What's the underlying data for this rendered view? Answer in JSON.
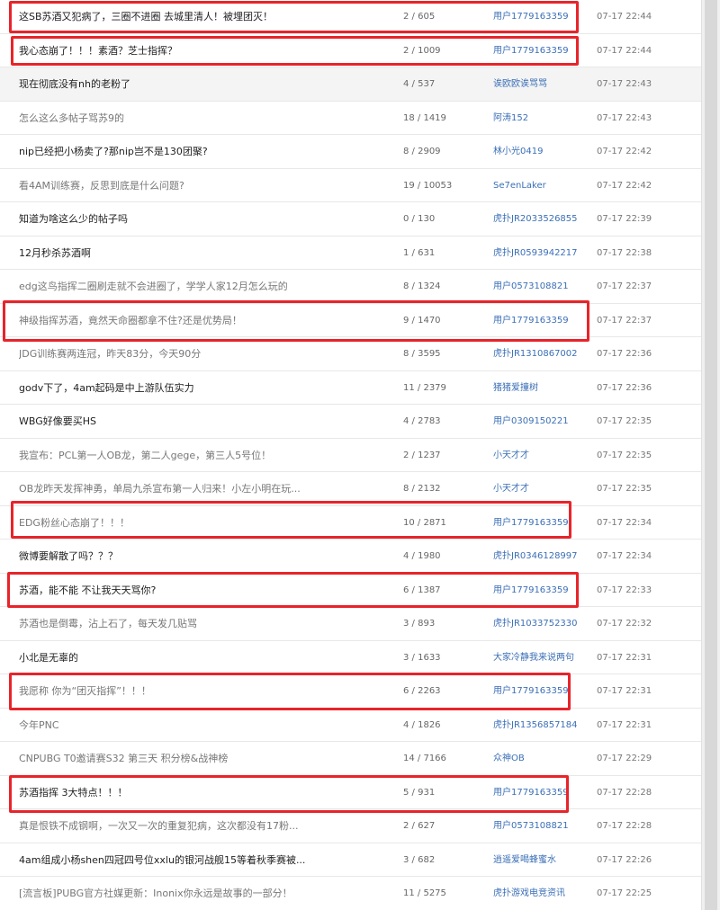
{
  "rows": [
    {
      "title": "这SB苏酒又犯病了，三圈不进圈 去城里清人！被埋团灭！",
      "count": "2 / 605",
      "user": "用户1779163359",
      "time": "07-17 22:44"
    },
    {
      "title": "我心态崩了！！！素酒？芝士指挥？",
      "count": "2 / 1009",
      "user": "用户1779163359",
      "time": "07-17 22:44"
    },
    {
      "title": "现在彻底没有nh的老粉了",
      "count": "4 / 537",
      "user": "诶欧欧诶骂骂",
      "time": "07-17 22:43"
    },
    {
      "title": "怎么这么多帖子骂苏9的",
      "count": "18 / 1419",
      "user": "阿涛152",
      "time": "07-17 22:43"
    },
    {
      "title": "nip已经把小杨卖了?那nip岂不是130团聚?",
      "count": "8 / 2909",
      "user": "林小光0419",
      "time": "07-17 22:42"
    },
    {
      "title": "看4AM训练赛，反思到底是什么问题?",
      "count": "19 / 10053",
      "user": "Se7enLaker",
      "time": "07-17 22:42"
    },
    {
      "title": "知道为啥这么少的帖子吗",
      "count": "0 / 130",
      "user": "虎扑JR2033526855",
      "time": "07-17 22:39"
    },
    {
      "title": "12月秒杀苏酒啊",
      "count": "1 / 631",
      "user": "虎扑JR0593942217",
      "time": "07-17 22:38"
    },
    {
      "title": "edg这鸟指挥二圈刷走就不会进圈了，学学人家12月怎么玩的",
      "count": "8 / 1324",
      "user": "用户0573108821",
      "time": "07-17 22:37"
    },
    {
      "title": "神级指挥苏酒，竟然天命圈都拿不住?还是优势局！",
      "count": "9 / 1470",
      "user": "用户1779163359",
      "time": "07-17 22:37"
    },
    {
      "title": "JDG训练赛两连冠，昨天83分，今天90分",
      "count": "8 / 3595",
      "user": "虎扑JR1310867002",
      "time": "07-17 22:36"
    },
    {
      "title": "godv下了，4am起码是中上游队伍实力",
      "count": "11 / 2379",
      "user": "猪猪爱撞树",
      "time": "07-17 22:36"
    },
    {
      "title": "WBG好像要买HS",
      "count": "4 / 2783",
      "user": "用户0309150221",
      "time": "07-17 22:35"
    },
    {
      "title": "我宣布：PCL第一人OB龙，第二人gege，第三人5号位！",
      "count": "2 / 1237",
      "user": "小天才才",
      "time": "07-17 22:35"
    },
    {
      "title": "OB龙昨天发挥神勇，单局九杀宣布第一人归来！小左小明在玩...",
      "count": "8 / 2132",
      "user": "小天才才",
      "time": "07-17 22:35"
    },
    {
      "title": "EDG粉丝心态崩了！！！",
      "count": "10 / 2871",
      "user": "用户1779163359",
      "time": "07-17 22:34"
    },
    {
      "title": "微博要解散了吗？？？",
      "count": "4 / 1980",
      "user": "虎扑JR0346128997",
      "time": "07-17 22:34"
    },
    {
      "title": "苏酒，能不能 不让我天天骂你?",
      "count": "6 / 1387",
      "user": "用户1779163359",
      "time": "07-17 22:33"
    },
    {
      "title": "苏酒也是倒霉，沾上石了，每天发几贴骂",
      "count": "3 / 893",
      "user": "虎扑JR1033752330",
      "time": "07-17 22:32"
    },
    {
      "title": "小北是无辜的",
      "count": "3 / 1633",
      "user": "大家冷静我来说两句",
      "time": "07-17 22:31"
    },
    {
      "title": "我愿称 你为“团灭指挥”！！！",
      "count": "6 / 2263",
      "user": "用户1779163359",
      "time": "07-17 22:31"
    },
    {
      "title": "今年PNC",
      "count": "4 / 1826",
      "user": "虎扑JR1356857184",
      "time": "07-17 22:31"
    },
    {
      "title": "CNPUBG T0邀请赛S32 第三天 积分榜&战神榜",
      "count": "14 / 7166",
      "user": "众神OB",
      "time": "07-17 22:29"
    },
    {
      "title": "苏酒指挥 3大特点！！！",
      "count": "5 / 931",
      "user": "用户1779163359",
      "time": "07-17 22:28"
    },
    {
      "title": "真是恨铁不成钢啊，一次又一次的重复犯病，这次都没有17粉...",
      "count": "2 / 627",
      "user": "用户0573108821",
      "time": "07-17 22:28"
    },
    {
      "title": "4am组成小杨shen四冠四号位xxlu的银河战舰15等着秋季赛被...",
      "count": "3 / 682",
      "user": "逍遥爱喝蜂蜜水",
      "time": "07-17 22:26"
    },
    {
      "title": "[流言板]PUBG官方社媒更新：Inonix你永远是故事的一部分！",
      "count": "11 / 5275",
      "user": "虎扑游戏电竞资讯",
      "time": "07-17 22:25"
    }
  ],
  "annotation_color": "#e8242a",
  "link_color": "#3b6fb6"
}
